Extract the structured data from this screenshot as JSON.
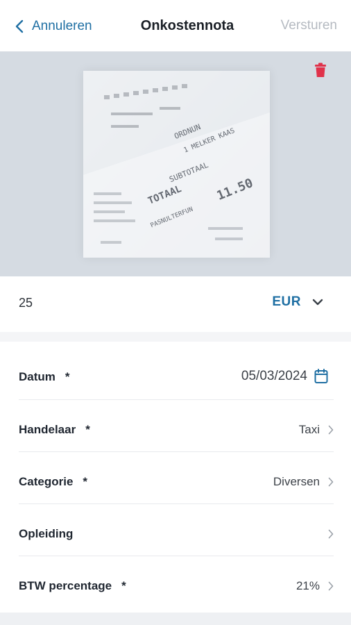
{
  "header": {
    "back_label": "Annuleren",
    "title": "Onkostennota",
    "send_label": "Versturen"
  },
  "receipt_image": {
    "text": {
      "line1": "SUBTOTAAL",
      "line2": "TOTAAL",
      "line3": "11.50",
      "line4": "1 MELKER KAAS",
      "line5": "ORDNUN",
      "line6": "PASNULTERFUN"
    }
  },
  "amount": {
    "value": "25",
    "currency": "EUR"
  },
  "fields": [
    {
      "label": "Datum",
      "required": "*",
      "value": "05/03/2024"
    },
    {
      "label": "Handelaar",
      "required": "*",
      "value": "Taxi"
    },
    {
      "label": "Categorie",
      "required": "*",
      "value": "Diversen"
    },
    {
      "label": "Opleiding",
      "required": "",
      "value": ""
    },
    {
      "label": "BTW percentage",
      "required": "*",
      "value": "21%"
    }
  ],
  "colors": {
    "accent": "#1f6fa3",
    "danger": "#e0324a",
    "disabled": "#b5bac1",
    "photo_bg": "#d5dbe2"
  },
  "icons": [
    "chevron-left-icon",
    "trash-icon",
    "chevron-down-icon",
    "calendar-icon",
    "chevron-right-icon"
  ]
}
